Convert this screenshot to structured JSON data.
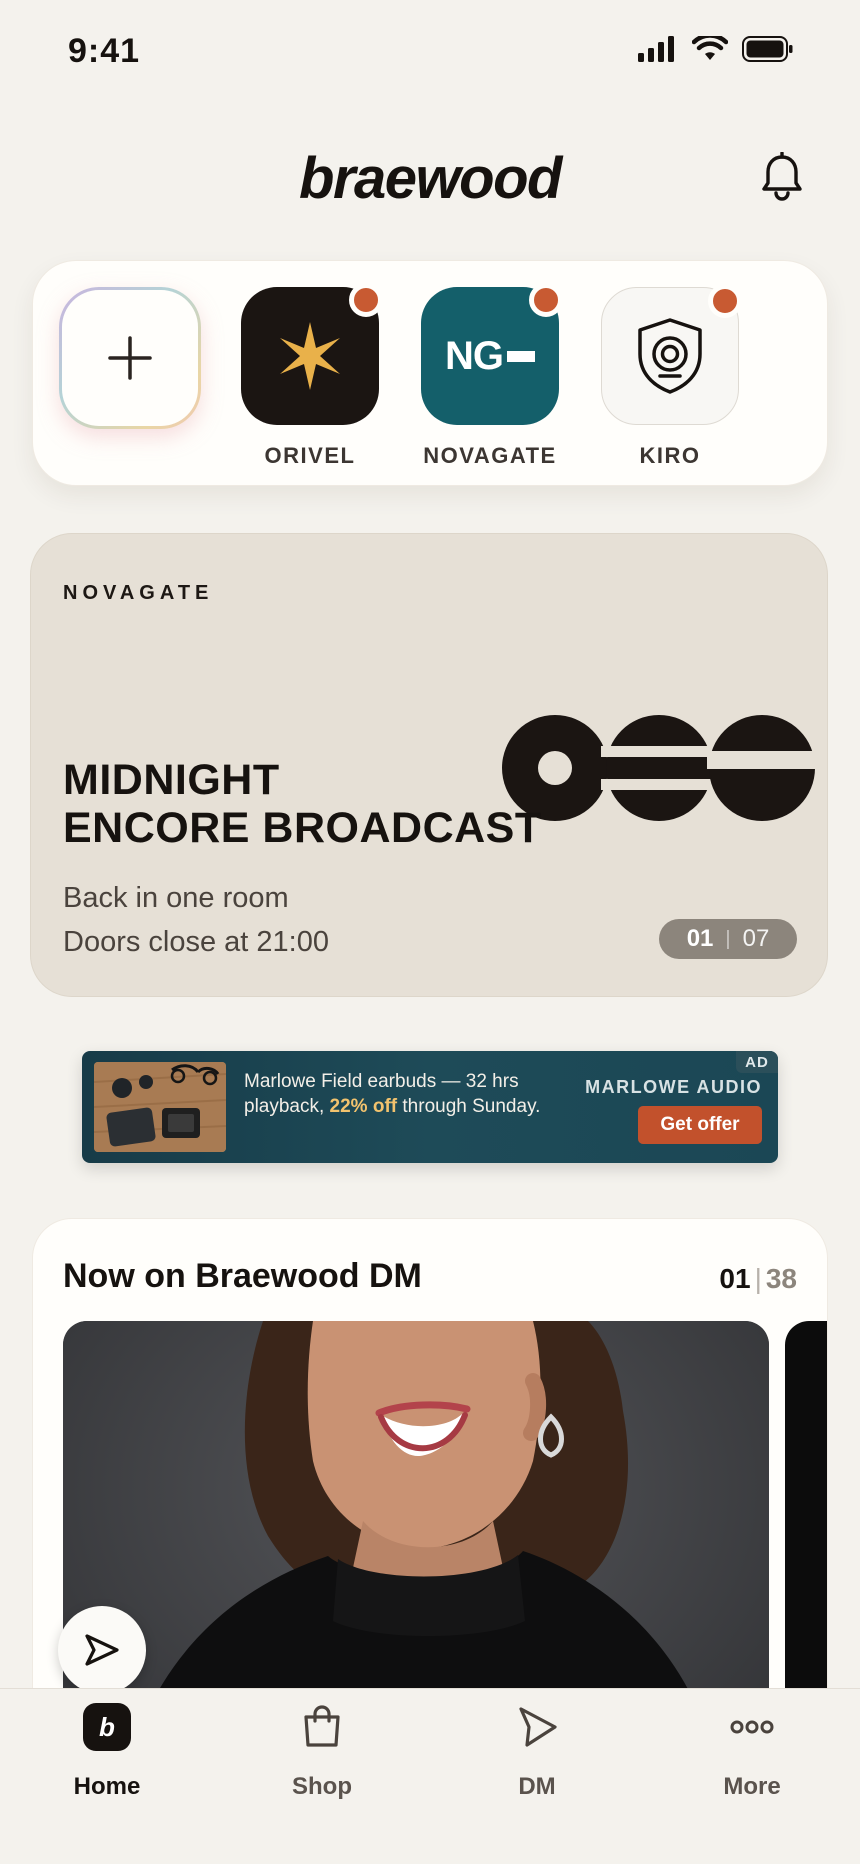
{
  "status_bar": {
    "time": "9:41"
  },
  "header": {
    "brand": "braewood",
    "bell_icon": "bell-icon"
  },
  "channels": {
    "add_icon": "plus-icon",
    "items": [
      {
        "label": "ORIVEL",
        "icon": "star-icon",
        "bg": "#1b1512",
        "unread": true
      },
      {
        "label": "NOVAGATE",
        "logo_text": "NG",
        "bg": "#145f6a",
        "unread": true
      },
      {
        "label": "KIRO",
        "icon": "shield-icon",
        "bg": "#f8f7f4",
        "unread": true
      }
    ]
  },
  "hero": {
    "kicker": "NOVAGATE",
    "title_line1": "MIDNIGHT",
    "title_line2": "ENCORE BROADCAST",
    "subtitle_line1": "Back in one room",
    "subtitle_line2": "Doors close at 21:00",
    "pager": {
      "current": "01",
      "separator": "|",
      "total": "07"
    }
  },
  "ad": {
    "badge": "AD",
    "text_before": "Marlowe Field earbuds — 32 hrs playback, ",
    "highlight": "22% off",
    "text_after": " through Sunday.",
    "brand": "MARLOWE AUDIO",
    "cta": "Get offer"
  },
  "dm": {
    "title": "Now on Braewood DM",
    "current": "01",
    "separator": "|",
    "total": "38",
    "send_icon": "send-icon"
  },
  "tabbar": {
    "items": [
      {
        "label": "Home",
        "icon": "home-logo-icon",
        "active": true
      },
      {
        "label": "Shop",
        "icon": "bag-icon",
        "active": false
      },
      {
        "label": "DM",
        "icon": "send-icon",
        "active": false
      },
      {
        "label": "More",
        "icon": "more-dots-icon",
        "active": false
      }
    ],
    "home_logo": "b"
  },
  "colors": {
    "background": "#f4f2ed",
    "accent": "#c85a32",
    "novagate_teal": "#145f6a",
    "hero_bg": "#e6e0d6"
  }
}
